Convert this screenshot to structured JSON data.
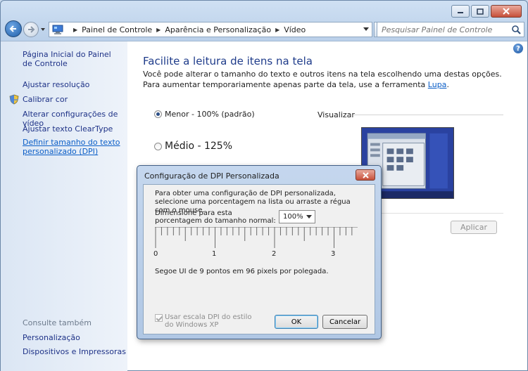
{
  "breadcrumb": [
    "Painel de Controle",
    "Aparência e Personalização",
    "Vídeo"
  ],
  "search": {
    "placeholder": "Pesquisar Painel de Controle"
  },
  "sidebar": {
    "home": "Página Inicial do Painel de Controle",
    "items": [
      "Ajustar resolução",
      "Calibrar cor",
      "Alterar configurações de vídeo",
      "Ajustar texto ClearType",
      "Definir tamanho do texto personalizado (DPI)"
    ],
    "see_also_label": "Consulte também",
    "see_also": [
      "Personalização",
      "Dispositivos e Impressoras"
    ]
  },
  "main": {
    "title": "Facilite a leitura de itens na tela",
    "description": "Você pode alterar o tamanho do texto e outros itens na tela escolhendo uma destas opções. Para aumentar temporariamente apenas parte da tela, use a ferramenta ",
    "description_link": "Lupa",
    "description_end": ".",
    "options": [
      {
        "label": "Menor - 100% (padrão)",
        "checked": true
      },
      {
        "label": "Médio - 125%",
        "checked": false
      }
    ],
    "preview_label": "Visualizar",
    "apply_label": "Aplicar"
  },
  "dialog": {
    "title": "Configuração de DPI Personalizada",
    "intro": "Para obter uma configuração de DPI personalizada, selecione uma porcentagem na lista ou arraste a régua com o mouse.",
    "scale_label": "Dimensione para esta porcentagem do tamanho normal:",
    "scale_value": "100%",
    "ruler_labels": [
      "0",
      "1",
      "2",
      "3"
    ],
    "font_info": "Segoe UI de 9 pontos em 96 pixels por polegada.",
    "xp_checkbox": "Usar escala DPI do estilo do Windows XP",
    "xp_checked": true,
    "ok_label": "OK",
    "cancel_label": "Cancelar"
  },
  "icons": {
    "back": "back-arrow-icon",
    "forward": "forward-arrow-icon",
    "refresh": "refresh-icon",
    "search": "magnifier-icon",
    "help": "help-icon",
    "shield": "uac-shield-icon"
  }
}
